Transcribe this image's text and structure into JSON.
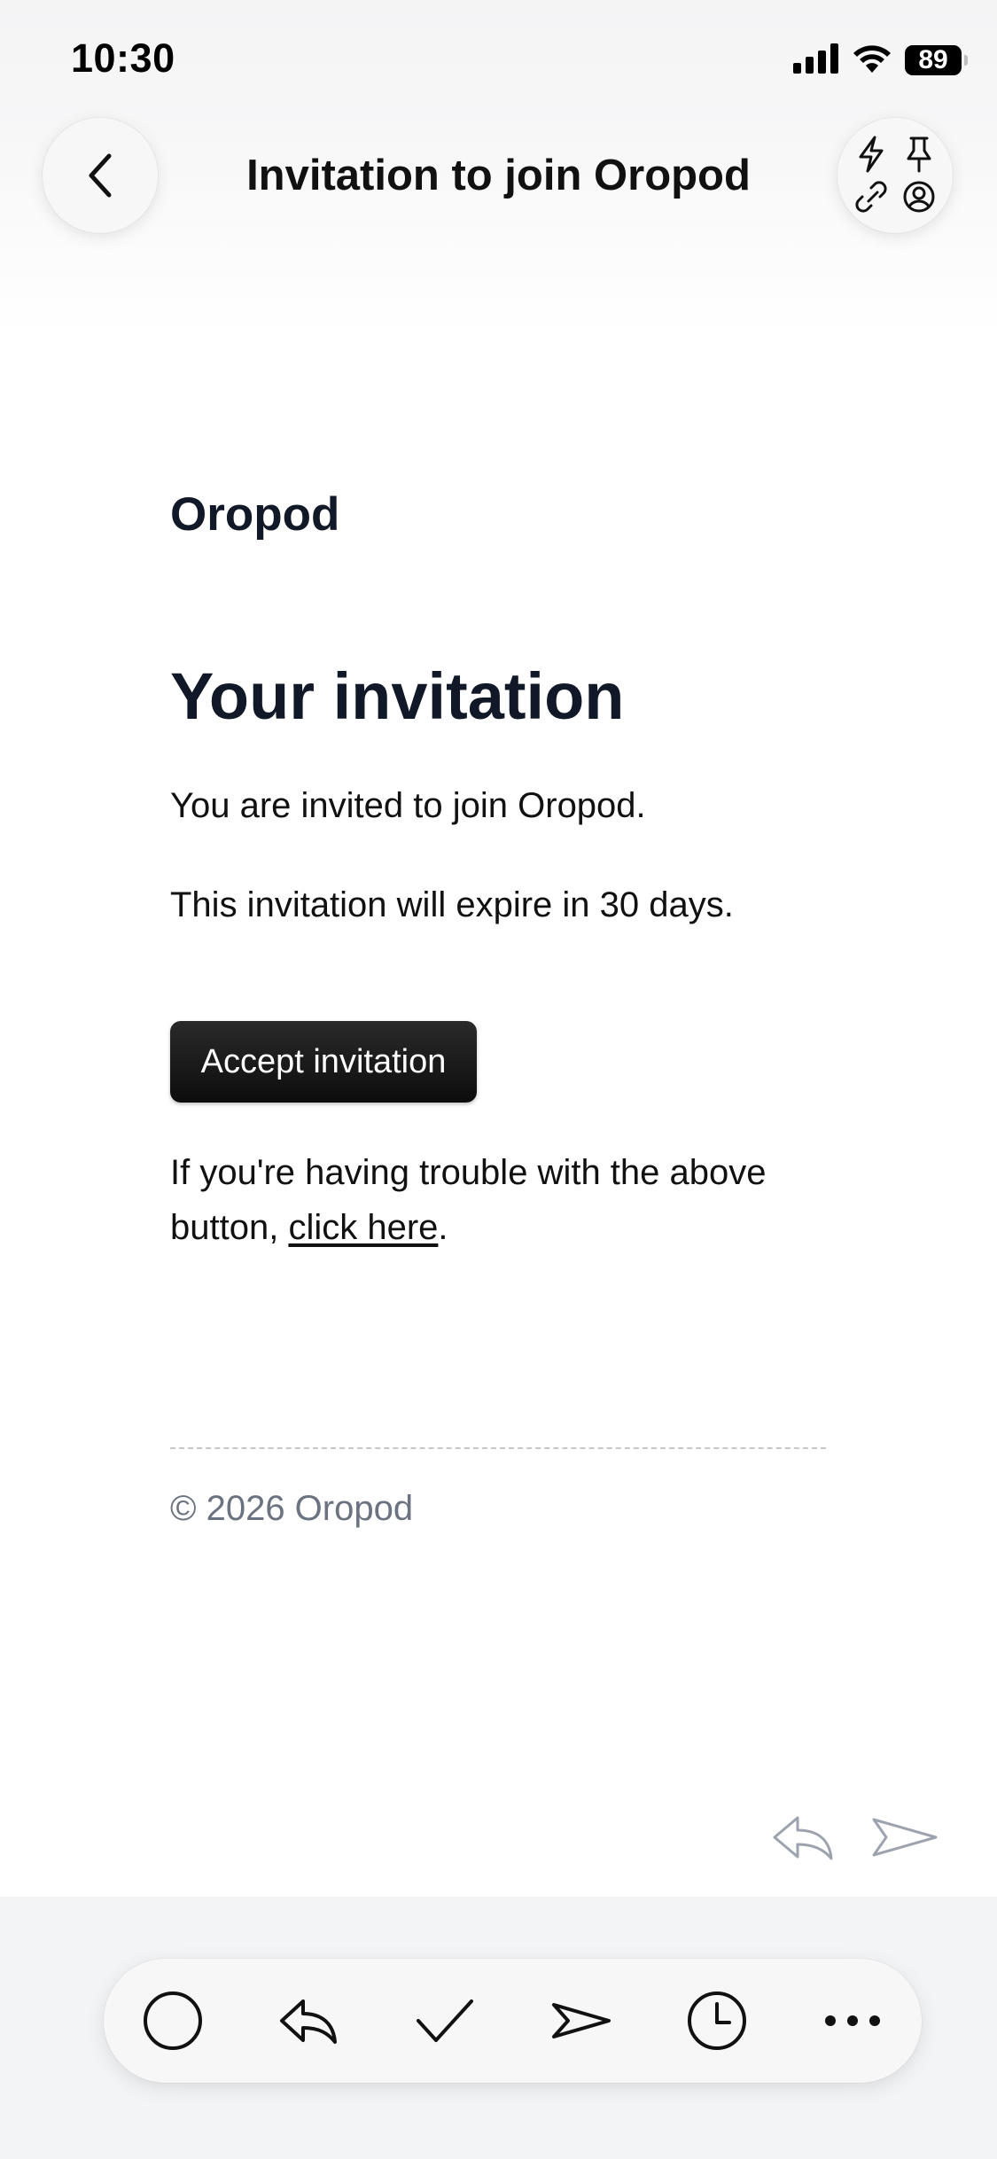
{
  "status_bar": {
    "time": "10:30",
    "battery": "89",
    "icons": [
      "signal-icon",
      "wifi-icon",
      "battery-icon"
    ]
  },
  "nav": {
    "title": "Invitation to join Oropod",
    "back_icon": "chevron-left-icon",
    "actions_icons": [
      "lightning-icon",
      "pin-icon",
      "link-icon",
      "contact-icon"
    ]
  },
  "email": {
    "brand": "Oropod",
    "heading": "Your invitation",
    "line1": "You are invited to join Oropod.",
    "line2": "This invitation will expire in 30 days.",
    "button_label": "Accept invitation",
    "trouble_prefix": "If you're having trouble with the above button, ",
    "trouble_link": "click here",
    "trouble_suffix": ".",
    "copyright": "© 2026 Oropod"
  },
  "message_nav": {
    "icons": [
      "reply-icon",
      "forward-icon"
    ]
  },
  "toolbar": {
    "icons": [
      "circle-icon",
      "reply-all-icon",
      "checkmark-icon",
      "send-icon",
      "clock-icon",
      "more-icon"
    ]
  },
  "colors": {
    "text": "#111827",
    "muted": "#6b7280",
    "button": "#111111",
    "toolbar_bg": "#f3f4f6"
  }
}
